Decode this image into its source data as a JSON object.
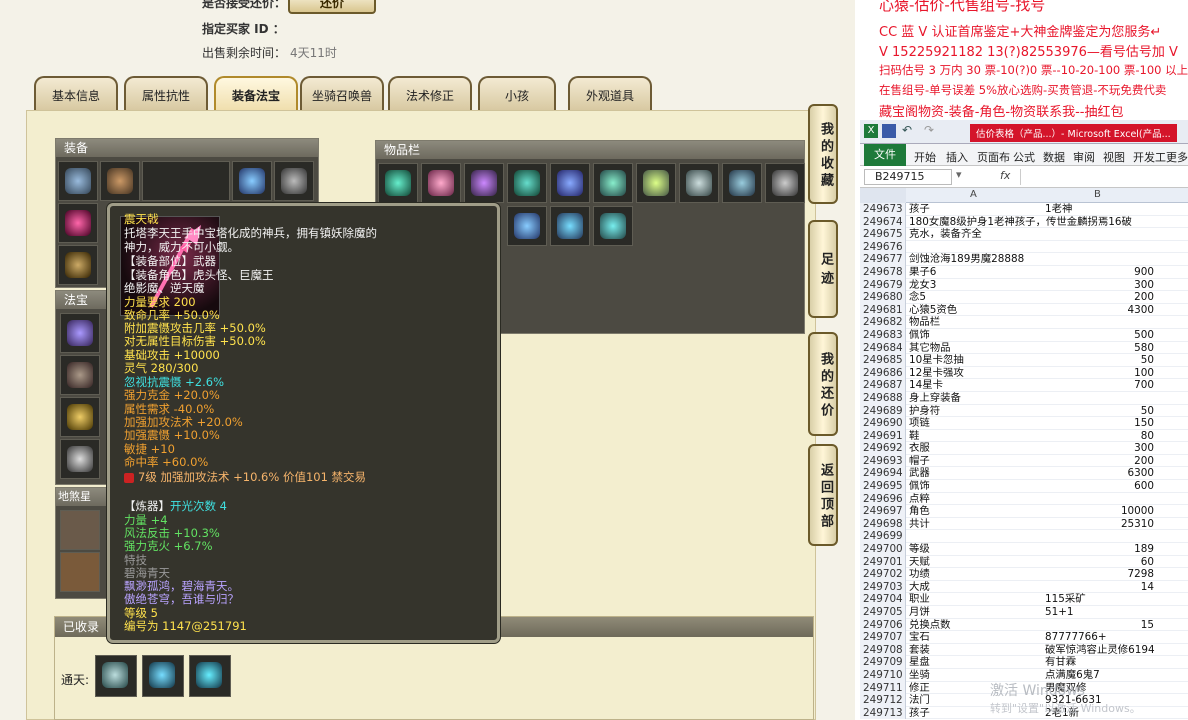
{
  "header": {
    "direct_sale_label": "是否接受还价：",
    "buy_button": "还价",
    "buyer_id_label": "指定买家 ID ：",
    "remaining_label": "出售剩余时间：",
    "remaining_value": "4天11时"
  },
  "tabs": [
    "基本信息",
    "属性抗性",
    "装备法宝",
    "坐骑召唤兽",
    "法术修正",
    "小孩",
    "外观道具"
  ],
  "active_tab": 2,
  "equip_title": "装备",
  "inventory_title": "物品栏",
  "fabao_title": "法宝",
  "disha_title": "地煞星",
  "collected_title": "已收录",
  "collected_label": "通天:",
  "side_buttons": [
    "我的收藏",
    "足迹",
    "我的还价",
    "返回顶部"
  ],
  "tooltip": {
    "name": "震天戟",
    "desc1": "托塔李天王手中宝塔化成的神兵，拥有镇妖除魔的",
    "desc2": "神力，威力不可小觑。",
    "part": "【装备部位】武器",
    "role1": "【装备角色】虎头怪、巨魔王",
    "role2": "绝影魔、逆天魔",
    "req": "力量要求 200",
    "crit": "致命几率 +50.0%",
    "shock_rate": "附加震慑攻击几率 +50.0%",
    "vs_none": "对无属性目标伤害 +50.0%",
    "base_atk": "基础攻击 +10000",
    "spirit": "灵气 280/300",
    "ignore": "忽视抗震慑 +2.6%",
    "gold": "强力克金 +20.0%",
    "attr_req": "属性需求 -40.0%",
    "boost_atk": "加强加攻法术 +20.0%",
    "boost_shock": "加强震慑 +10.0%",
    "agi": "敏捷 +10",
    "hit": "命中率 +60.0%",
    "gem": "7级 加强加攻法术 +10.6% 价值101 禁交易",
    "refine_head": "【炼器】",
    "refine_count": "开光次数 4",
    "r_str": "力量 +4",
    "r_wind": "风法反击 +10.3%",
    "r_fire": "强力克火 +6.7%",
    "skill_head": "特技",
    "skill_name": "碧海青天",
    "poem1": "飘渺孤鸿，碧海青天。",
    "poem2": "傲绝苍穹，吾谁与归？",
    "level": "等级 5",
    "serial": "编号为 1147@251791"
  },
  "right_ads": [
    "心猿-估价-代售组号-找号",
    "CC 蓝 V 认证首席鉴定+大神金牌鉴定为您服务↵",
    "V 15225921182      13(?)82553976—看号估号加 V",
    "扫码估号 3 万内 30 票-10(?)0 票--10-20-100 票-100 以上 150",
    "在售组号-单号误差 5%放心选购-买贵管退-不玩免费代卖",
    "藏宝阁物资-装备-角色-物资联系我--抽红包"
  ],
  "excel": {
    "title": "估价表格（产品...）- Microsoft Excel(产品...",
    "ribbon": [
      "文件",
      "开始",
      "插入",
      "页面布",
      "公式",
      "数据",
      "审阅",
      "视图",
      "开发工",
      "更多"
    ],
    "namebox": "B249715",
    "fx": "fx",
    "col_a": "A",
    "col_b": "B",
    "rows": [
      [
        "249673",
        "孩子",
        "1老神"
      ],
      [
        "249674",
        "180女魔8级护身1老神孩子，传世金麟拐焉16破",
        ""
      ],
      [
        "249675",
        "克水，装备齐全",
        ""
      ],
      [
        "249676",
        "",
        ""
      ],
      [
        "249677",
        "剑蚀沧海189男魔28888",
        ""
      ],
      [
        "249678",
        "果子6",
        "900"
      ],
      [
        "249679",
        "龙女3",
        "300"
      ],
      [
        "249680",
        "念5",
        "200"
      ],
      [
        "249681",
        "心猿5资色",
        "4300"
      ],
      [
        "249682",
        "物品栏",
        ""
      ],
      [
        "249683",
        "佩饰",
        "500"
      ],
      [
        "249684",
        "其它物品",
        "580"
      ],
      [
        "249685",
        "10星卡忽抽",
        "50"
      ],
      [
        "249686",
        "12星卡强攻",
        "100"
      ],
      [
        "249687",
        "14星卡",
        "700"
      ],
      [
        "249688",
        "身上穿装备",
        ""
      ],
      [
        "249689",
        "护身符",
        "50"
      ],
      [
        "249690",
        "项链",
        "150"
      ],
      [
        "249691",
        "鞋",
        "80"
      ],
      [
        "249692",
        "衣服",
        "300"
      ],
      [
        "249693",
        "帽子",
        "200"
      ],
      [
        "249694",
        "武器",
        "6300"
      ],
      [
        "249695",
        "佩饰",
        "600"
      ],
      [
        "249696",
        "点粹",
        ""
      ],
      [
        "249697",
        "角色",
        "10000"
      ],
      [
        "249698",
        "共计",
        "25310"
      ],
      [
        "249699",
        "",
        ""
      ],
      [
        "249700",
        "等级",
        "189"
      ],
      [
        "249701",
        "天赋",
        "60"
      ],
      [
        "249702",
        "功绩",
        "7298"
      ],
      [
        "249703",
        "大成",
        "14"
      ],
      [
        "249704",
        "职业",
        "115采矿"
      ],
      [
        "249705",
        "月饼",
        "51+1"
      ],
      [
        "249706",
        "兑换点数",
        "15"
      ],
      [
        "249707",
        "宝石",
        "87777766+"
      ],
      [
        "249708",
        "套装",
        "破军惊鸿容止灵修6194"
      ],
      [
        "249709",
        "星盘",
        "有甘霖"
      ],
      [
        "249710",
        "坐骑",
        "点满魔6鬼7"
      ],
      [
        "249711",
        "修正",
        "男魔双修"
      ],
      [
        "249712",
        "法门",
        "9321-6631"
      ],
      [
        "249713",
        "孩子",
        "2老1新"
      ]
    ]
  },
  "watermark1": "激活 Windows",
  "watermark2": "转到\"设置\"以激活 Windows。",
  "colors": {
    "tooltip_bg": "#35342c",
    "accent": "#b08a2b",
    "ad_red": "#e8162b"
  }
}
